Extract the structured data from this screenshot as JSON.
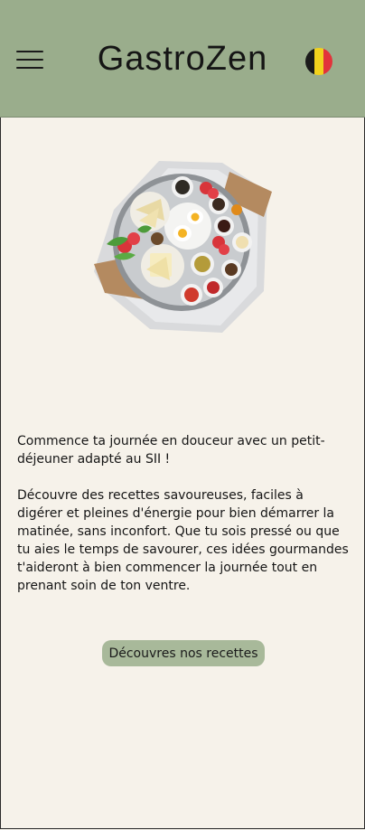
{
  "header": {
    "brand": "GastroZen",
    "menu_icon": "hamburger-menu-icon",
    "flag_icon": "belgium-flag-icon",
    "flag_colors": [
      "#1b1b1b",
      "#f2d21d",
      "#e2333b"
    ],
    "background": "#9aad8c"
  },
  "hero": {
    "image_icon": "breakfast-platter-illustration"
  },
  "content": {
    "lead": "Commence ta journée en douceur avec un petit-déjeuner adapté au SII !",
    "body": "Découvre des recettes savoureuses, faciles à digérer et pleines d'énergie pour bien démarrer la matinée, sans inconfort. Que tu sois pressé ou que tu aies le temps de savourer, ces idées gourmandes t'aideront à bien commencer la journée tout en prenant soin de ton ventre."
  },
  "cta": {
    "label": "Découvres nos recettes",
    "color": "#a8b99a"
  },
  "page_background": "#f6f2ea"
}
